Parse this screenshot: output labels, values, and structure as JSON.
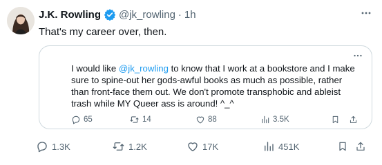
{
  "author": {
    "display_name": "J.K. Rowling",
    "handle": "@jk_rowling",
    "separator": "·",
    "time": "1h",
    "verified_icon": "verified-badge-icon",
    "avatar_icon": "profile-avatar"
  },
  "tweet": {
    "text": "That's my career over, then."
  },
  "more_icon": "more-icon",
  "quote": {
    "text_before": "I would like ",
    "mention": "@jk_rowling",
    "text_after": " to know that I work at a bookstore and I make sure to spine-out her gods-awful books as much as possible, rather than front-face them out. We don't promote transphobic and ableist trash while MY Queer ass is around! ^_^",
    "stats": {
      "replies": "65",
      "reposts": "14",
      "likes": "88",
      "views": "3.5K"
    }
  },
  "stats": {
    "replies": "1.3K",
    "reposts": "1.2K",
    "likes": "17K",
    "views": "451K"
  },
  "icons": {
    "reply": "reply-icon",
    "repost": "repost-icon",
    "like": "heart-icon",
    "views": "views-icon",
    "bookmark": "bookmark-icon",
    "share": "share-icon"
  },
  "colors": {
    "accent": "#1d9bf0",
    "muted": "#536471",
    "text": "#0f1419",
    "border": "#cfd9de"
  }
}
